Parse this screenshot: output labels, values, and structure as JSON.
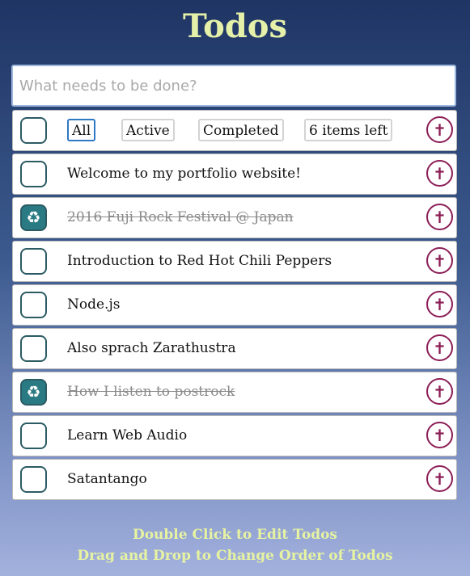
{
  "app": {
    "title": "Todos"
  },
  "new_todo": {
    "placeholder": "What needs to be done?",
    "value": ""
  },
  "toolbar": {
    "filters": [
      {
        "label": "All",
        "selected": true
      },
      {
        "label": "Active",
        "selected": false
      },
      {
        "label": "Completed",
        "selected": false
      }
    ],
    "count_label": "6 items left",
    "toggle_icon": "checkbox-icon",
    "delete_icon": "cross-icon"
  },
  "todos": [
    {
      "text": "Welcome to my portfolio website!",
      "completed": false
    },
    {
      "text": "2016 Fuji Rock Festival @ Japan",
      "completed": true
    },
    {
      "text": "Introduction to Red Hot Chili Peppers",
      "completed": false
    },
    {
      "text": "Node.js",
      "completed": false
    },
    {
      "text": "Also sprach Zarathustra",
      "completed": false
    },
    {
      "text": "How I listen to postrock",
      "completed": true
    },
    {
      "text": "Learn Web Audio",
      "completed": false
    },
    {
      "text": "Satantango",
      "completed": false
    }
  ],
  "footer": {
    "line1": "Double Click to Edit Todos",
    "line2": "Drag and Drop to Change Order of Todos"
  },
  "colors": {
    "title": "#e5f0a8",
    "check_border": "#2b5b63",
    "check_done": "#2a7a84",
    "delete": "#8b1d55",
    "filter_selected": "#2f78c4"
  }
}
